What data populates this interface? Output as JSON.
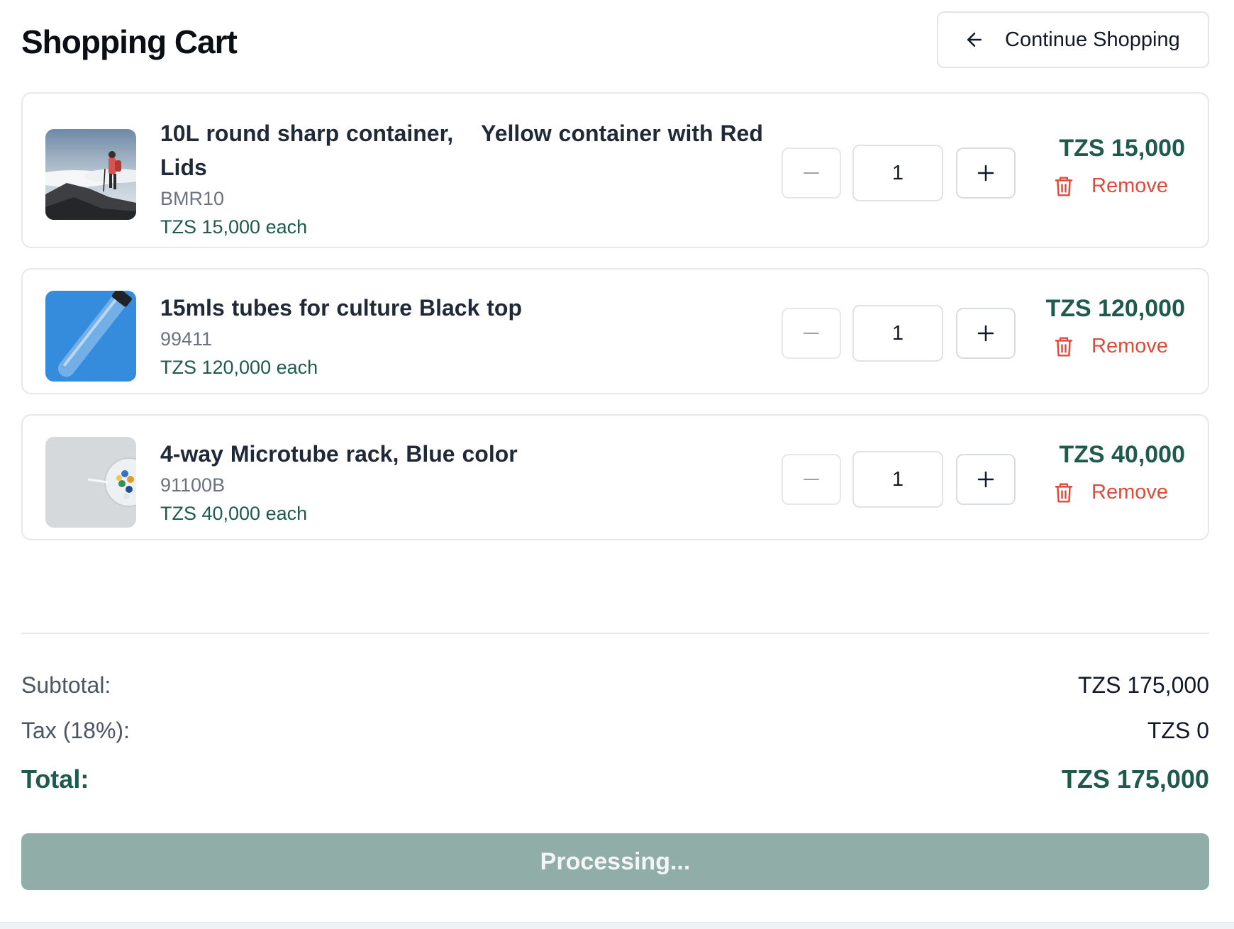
{
  "header": {
    "title": "Shopping Cart",
    "continue_label": "Continue Shopping",
    "continue_icon": "arrow-left-icon"
  },
  "items": [
    {
      "name": "10L round sharp container,    Yellow container with Red Lids",
      "sku": "BMR10",
      "unit_price": "TZS 15,000 each",
      "quantity": "1",
      "line_total": "TZS 15,000",
      "remove_label": "Remove",
      "image": "hiker-on-mountain-photo"
    },
    {
      "name": "15mls tubes for culture Black top",
      "sku": "99411",
      "unit_price": "TZS 120,000 each",
      "quantity": "1",
      "line_total": "TZS 120,000",
      "remove_label": "Remove",
      "image": "glass-tube-photo"
    },
    {
      "name": "4-way Microtube rack, Blue color",
      "sku": "91100B",
      "unit_price": "TZS 40,000 each",
      "quantity": "1",
      "line_total": "TZS 40,000",
      "remove_label": "Remove",
      "image": "pills-bowl-photo"
    }
  ],
  "summary": {
    "subtotal_label": "Subtotal:",
    "subtotal_value": "TZS 175,000",
    "tax_label": "Tax (18%):",
    "tax_value": "TZS 0",
    "total_label": "Total:",
    "total_value": "TZS 175,000"
  },
  "checkout": {
    "label": "Processing..."
  },
  "colors": {
    "accent": "#1e5b4d",
    "danger": "#dc4b3c",
    "button_disabled": "#91ada8"
  }
}
